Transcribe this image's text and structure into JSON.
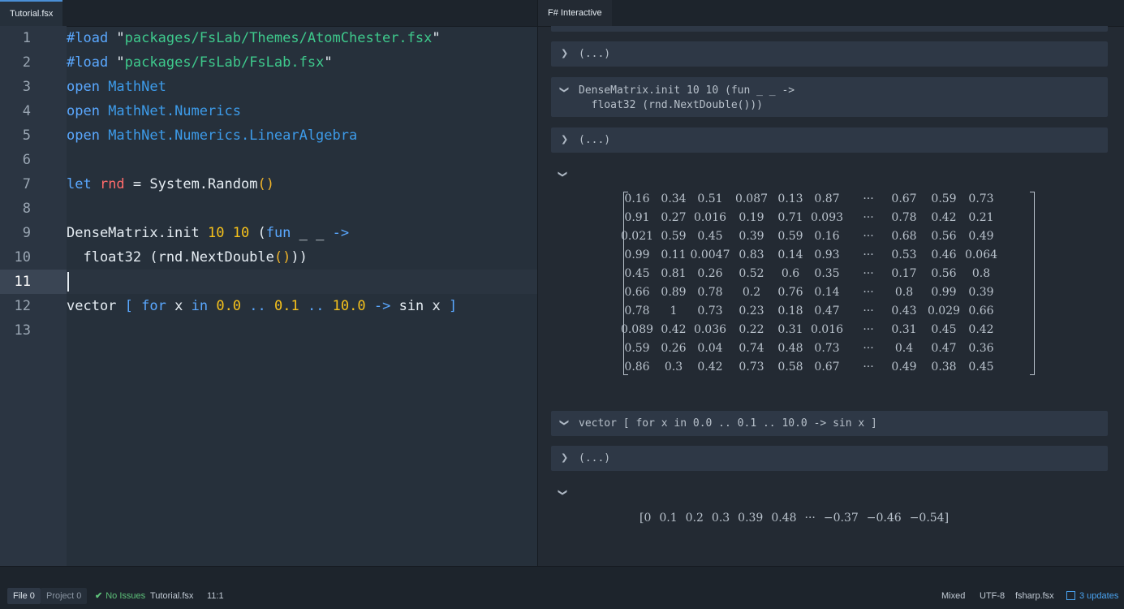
{
  "editor": {
    "tab_label": "Tutorial.fsx",
    "line_numbers": [
      "1",
      "2",
      "3",
      "4",
      "5",
      "6",
      "7",
      "8",
      "9",
      "10",
      "11",
      "12",
      "13"
    ],
    "code": {
      "l1": {
        "kw": "#load ",
        "q1": "\"",
        "str": "packages/FsLab/Themes/AtomChester.fsx",
        "q2": "\""
      },
      "l2": {
        "kw": "#load ",
        "q1": "\"",
        "str": "packages/FsLab/FsLab.fsx",
        "q2": "\""
      },
      "l3": {
        "kw": "open ",
        "ns": "MathNet"
      },
      "l4": {
        "kw": "open ",
        "ns": "MathNet.Numerics"
      },
      "l5": {
        "kw": "open ",
        "ns": "MathNet.Numerics.LinearAlgebra"
      },
      "l7": {
        "kw": "let ",
        "id": "rnd",
        "eq": " = ",
        "call": "System.Random",
        "paren": "()"
      },
      "l9": {
        "a": "DenseMatrix.init ",
        "n1": "10",
        "sp": " ",
        "n2": "10",
        "b": " (",
        "kw": "fun",
        "c": " _ _ ",
        "arrow": "->"
      },
      "l10": {
        "a": "  float32 (rnd.NextDouble",
        "paren": "()",
        "b": "))"
      },
      "l12": {
        "a": "vector ",
        "br1": "[",
        "sp1": " ",
        "kw1": "for",
        "b": " x ",
        "kw2": "in",
        "sp2": " ",
        "n1": "0.0",
        "d1": " .. ",
        "n2": "0.1",
        "d2": " .. ",
        "n3": "10.0",
        "arr": " -> ",
        "c": "sin x ",
        "br2": "]"
      }
    }
  },
  "fsi": {
    "tab_label": "F# Interactive",
    "collapsed_label": "(...)",
    "cells": {
      "matrix_expr_line1": "DenseMatrix.init 10 10 (fun _ _ ->",
      "matrix_expr_line2": "  float32 (rnd.NextDouble()))",
      "vector_expr": "vector [ for x in 0.0 .. 0.1 .. 10.0 -> sin x ]"
    },
    "matrix": [
      [
        "0.16",
        "0.34",
        "0.51",
        "0.087",
        "0.13",
        "0.87",
        "···",
        "0.67",
        "0.59",
        "0.73"
      ],
      [
        "0.91",
        "0.27",
        "0.016",
        "0.19",
        "0.71",
        "0.093",
        "···",
        "0.78",
        "0.42",
        "0.21"
      ],
      [
        "0.021",
        "0.59",
        "0.45",
        "0.39",
        "0.59",
        "0.16",
        "···",
        "0.68",
        "0.56",
        "0.49"
      ],
      [
        "0.99",
        "0.11",
        "0.0047",
        "0.83",
        "0.14",
        "0.93",
        "···",
        "0.53",
        "0.46",
        "0.064"
      ],
      [
        "0.45",
        "0.81",
        "0.26",
        "0.52",
        "0.6",
        "0.35",
        "···",
        "0.17",
        "0.56",
        "0.8"
      ],
      [
        "0.66",
        "0.89",
        "0.78",
        "0.2",
        "0.76",
        "0.14",
        "···",
        "0.8",
        "0.99",
        "0.39"
      ],
      [
        "0.78",
        "1",
        "0.73",
        "0.23",
        "0.18",
        "0.47",
        "···",
        "0.43",
        "0.029",
        "0.66"
      ],
      [
        "0.089",
        "0.42",
        "0.036",
        "0.22",
        "0.31",
        "0.016",
        "···",
        "0.31",
        "0.45",
        "0.42"
      ],
      [
        "0.59",
        "0.26",
        "0.04",
        "0.74",
        "0.48",
        "0.73",
        "···",
        "0.4",
        "0.47",
        "0.36"
      ],
      [
        "0.86",
        "0.3",
        "0.42",
        "0.73",
        "0.58",
        "0.67",
        "···",
        "0.49",
        "0.38",
        "0.45"
      ]
    ],
    "vector": [
      "[0",
      "0.1",
      "0.2",
      "0.3",
      "0.39",
      "0.48",
      "···",
      "−0.37",
      "−0.46",
      "−0.54]"
    ]
  },
  "status": {
    "file_tab": "File  0",
    "project_tab": "Project  0",
    "issues": "No Issues",
    "filename": "Tutorial.fsx",
    "cursor_pos": "11:1",
    "line_ending": "Mixed",
    "encoding": "UTF-8",
    "grammar": "fsharp.fsx",
    "updates": "3 updates"
  },
  "colors": {
    "keyword": "#5aa8ff",
    "string": "#3ec98c",
    "number": "#f7c21b",
    "identifier": "#ff6b6b",
    "ok": "#5ec27a",
    "link": "#4aa3f0"
  },
  "icons": [
    "chevron-right-icon",
    "chevron-down-icon",
    "check-icon",
    "package-icon"
  ]
}
